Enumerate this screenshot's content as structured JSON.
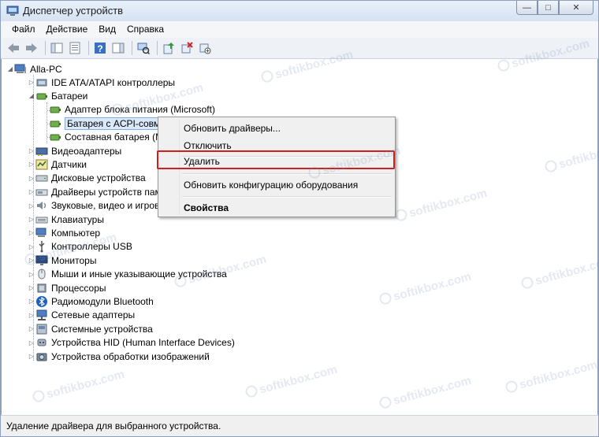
{
  "window": {
    "title": "Диспетчер устройств",
    "minimize_glyph": "—",
    "maximize_glyph": "□",
    "close_glyph": "✕"
  },
  "menu": [
    "Файл",
    "Действие",
    "Вид",
    "Справка"
  ],
  "tree": {
    "root": "Alla-PC",
    "items": [
      {
        "label": "IDE ATA/ATAPI контроллеры",
        "icon": "ide-controller-icon",
        "expanded": false
      },
      {
        "label": "Батареи",
        "icon": "battery-icon",
        "expanded": true
      },
      {
        "label": "Адаптер блока питания (Microsoft)",
        "icon": "battery-device-icon",
        "child": true
      },
      {
        "label": "Батарея с ACPI-совме",
        "icon": "battery-device-icon",
        "child": true,
        "selected": true
      },
      {
        "label": "Составная батарея (М",
        "icon": "battery-device-icon",
        "child": true
      },
      {
        "label": "Видеоадаптеры",
        "icon": "display-adapter-icon",
        "expanded": false
      },
      {
        "label": "Датчики",
        "icon": "sensor-icon",
        "expanded": false
      },
      {
        "label": "Дисковые устройства",
        "icon": "disk-drive-icon",
        "expanded": false
      },
      {
        "label": "Драйверы устройств пам",
        "icon": "storage-driver-icon",
        "expanded": false
      },
      {
        "label": "Звуковые, видео и игрово",
        "icon": "sound-icon",
        "expanded": false
      },
      {
        "label": "Клавиатуры",
        "icon": "keyboard-icon",
        "expanded": false
      },
      {
        "label": "Компьютер",
        "icon": "computer-icon",
        "expanded": false
      },
      {
        "label": "Контроллеры USB",
        "icon": "usb-icon",
        "expanded": false
      },
      {
        "label": "Мониторы",
        "icon": "monitor-icon",
        "expanded": false
      },
      {
        "label": "Мыши и иные указывающие устройства",
        "icon": "mouse-icon",
        "expanded": false
      },
      {
        "label": "Процессоры",
        "icon": "processor-icon",
        "expanded": false
      },
      {
        "label": "Радиомодули Bluetooth",
        "icon": "bluetooth-icon",
        "expanded": false
      },
      {
        "label": "Сетевые адаптеры",
        "icon": "network-adapter-icon",
        "expanded": false
      },
      {
        "label": "Системные устройства",
        "icon": "system-device-icon",
        "expanded": false
      },
      {
        "label": "Устройства HID (Human Interface Devices)",
        "icon": "hid-icon",
        "expanded": false
      },
      {
        "label": "Устройства обработки изображений",
        "icon": "imaging-device-icon",
        "expanded": false
      }
    ]
  },
  "context_menu": {
    "update_drivers": "Обновить драйверы...",
    "disable": "Отключить",
    "uninstall": "Удалить",
    "scan_hardware": "Обновить конфигурацию оборудования",
    "properties": "Свойства"
  },
  "status": "Удаление драйвера для выбранного устройства.",
  "watermark": "softikbox.com",
  "colors": {
    "highlight_box": "#cc1f1f",
    "selection": "#d9e8fb"
  }
}
